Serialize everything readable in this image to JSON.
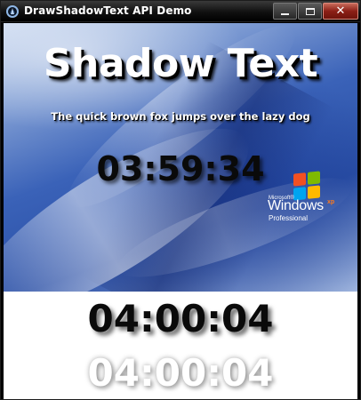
{
  "window": {
    "title": "DrawShadowText API Demo",
    "controls": {
      "minimize_icon": "minimize-icon",
      "maximize_icon": "maximize-icon",
      "close_symbol": "✕"
    }
  },
  "wallpaper": {
    "headline": "Shadow Text",
    "subtitle": "The quick brown fox jumps over the lazy dog",
    "clock": "03:59:34",
    "logo": {
      "microsoft": "Microsoft®",
      "windows": "Windows",
      "xp": "xp",
      "edition": "Professional"
    }
  },
  "white_area": {
    "clock": "04:00:04",
    "ghost_clock": "04:00:04"
  },
  "colors": {
    "title_bar": "#101010",
    "close_button": "#8c2016",
    "wallpaper_blue": "#3a62b8"
  }
}
